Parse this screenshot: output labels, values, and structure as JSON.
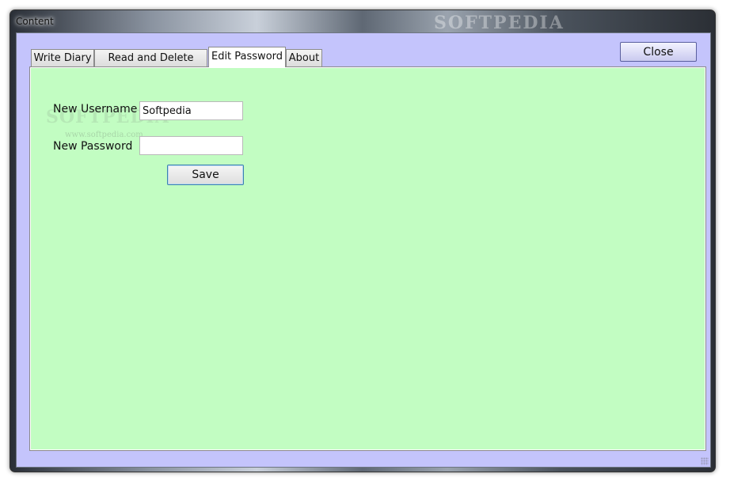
{
  "window": {
    "title": "Content",
    "title_watermark": "SOFTPEDIA"
  },
  "toolbar": {
    "close_label": "Close"
  },
  "tabs": [
    {
      "label": "Write Diary"
    },
    {
      "label": "Read and Delete Diary"
    },
    {
      "label": "Edit Password",
      "selected": true
    },
    {
      "label": "About"
    }
  ],
  "form": {
    "username_label": "New Username",
    "username_value": "Softpedia",
    "password_label": "New Password",
    "password_value": "",
    "save_label": "Save"
  },
  "watermark": {
    "logo": "SOFTPEDIA",
    "url": "www.softpedia.com"
  },
  "colors": {
    "client_background": "#c4c4fc",
    "panel_background": "#c2fdc2",
    "focus_border": "#3c7fb1"
  }
}
